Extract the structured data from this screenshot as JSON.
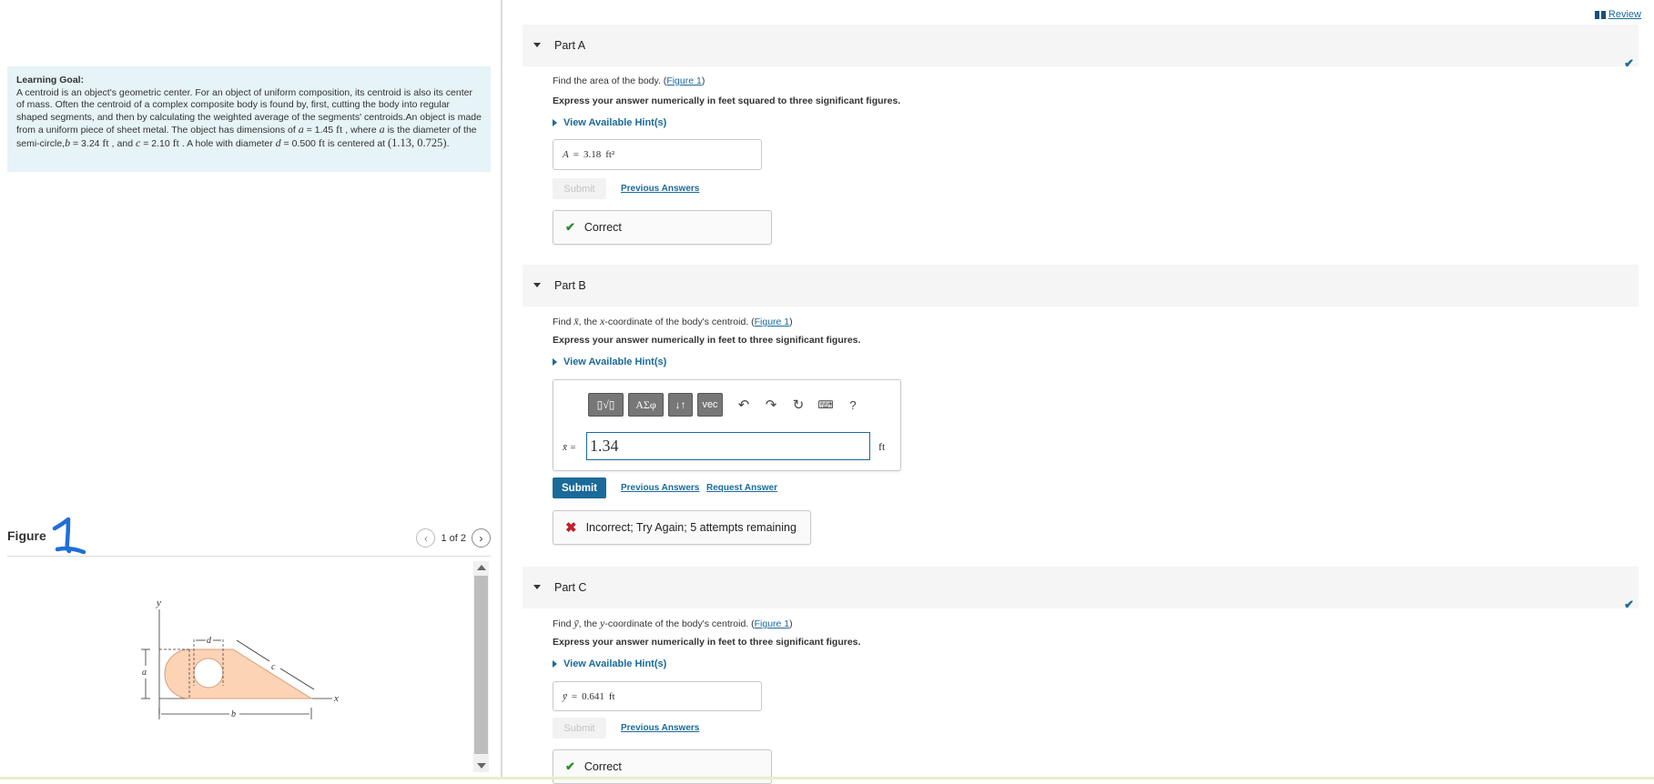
{
  "learning_goal": {
    "title": "Learning Goal:",
    "text1": "A centroid is an object's geometric center. For an object of uniform composition, its centroid is also its center of mass. Often the centroid of a complex composite body is found by, first, cutting the body into regular shaped segments, and then by calculating the weighted average of the segments' centroids.An object is made from a uniform piece of sheet metal. The object has dimensions of ",
    "a_sym": "a",
    "a_val": " = 1.45 ",
    "a_unit": "ft",
    "text2": " , where ",
    "a_sym2": "a",
    "text3": " is the diameter of the semi-circle,",
    "b_sym": "b",
    "b_val": " = 3.24 ",
    "b_unit": "ft",
    "text4": " , and ",
    "c_sym": "c",
    "c_val": " = 2.10 ",
    "c_unit": "ft",
    "text5": " . A hole with diameter ",
    "d_sym": "d",
    "d_val": " = 0.500 ",
    "d_unit": "ft",
    "text6": " is centered at ",
    "center": "(1.13, 0.725)",
    "text7": "."
  },
  "figure": {
    "title": "Figure",
    "scrawl": "1",
    "pager_text": "1 of 2",
    "prev_icon": "chevron-left-icon",
    "next_icon": "chevron-right-icon",
    "labels": {
      "y": "y",
      "x": "x",
      "a": "a",
      "b": "b",
      "c": "c",
      "d": "d"
    },
    "colors": {
      "shape_fill": "#fdd3b5",
      "shape_stroke": "#d89d78"
    }
  },
  "review": {
    "label": "Review",
    "icon": "book-icon"
  },
  "part_a": {
    "title": "Part A",
    "question_pre": "Find the area of the body. (",
    "figure_link": "Figure 1",
    "question_post": ")",
    "express": "Express your answer numerically in feet squared to three significant figures.",
    "hint": "View Available Hint(s)",
    "answer_var": "A",
    "answer_eq": "=",
    "answer_value": "3.18",
    "answer_unit": "ft²",
    "submit": "Submit",
    "previous": "Previous Answers",
    "feedback": "Correct"
  },
  "part_b": {
    "title": "Part B",
    "question_pre": "Find ",
    "var": "x̄",
    "question_mid": ", the ",
    "var2": "x",
    "question_mid2": "-coordinate of the body's centroid. (",
    "figure_link": "Figure 1",
    "question_post": ")",
    "express": "Express your answer numerically in feet to three significant figures.",
    "hint": "View Available Hint(s)",
    "toolbar": {
      "templates": "▯√▯",
      "symbols": "ΑΣφ",
      "arrows": "↓↑",
      "vec": "vec",
      "help": "?"
    },
    "answer_label": "x̄ =",
    "answer_value": "1.34",
    "answer_unit": "ft",
    "submit": "Submit",
    "previous": "Previous Answers",
    "request": "Request Answer",
    "feedback": "Incorrect; Try Again; 5 attempts remaining"
  },
  "part_c": {
    "title": "Part C",
    "question_pre": "Find ",
    "var": "ȳ",
    "question_mid": ", the ",
    "var2": "y",
    "question_mid2": "-coordinate of the body's centroid. (",
    "figure_link": "Figure 1",
    "question_post": ")",
    "express": "Express your answer numerically in feet to three significant figures.",
    "hint": "View Available Hint(s)",
    "answer_var": "ȳ",
    "answer_eq": "=",
    "answer_value": "0.641",
    "answer_unit": "ft",
    "submit": "Submit",
    "previous": "Previous Answers",
    "feedback": "Correct"
  },
  "colors": {
    "accent": "#1a6a9a",
    "correct": "#2e8b2e",
    "incorrect": "#c0202a",
    "goal_bg": "#e6f3f7"
  }
}
